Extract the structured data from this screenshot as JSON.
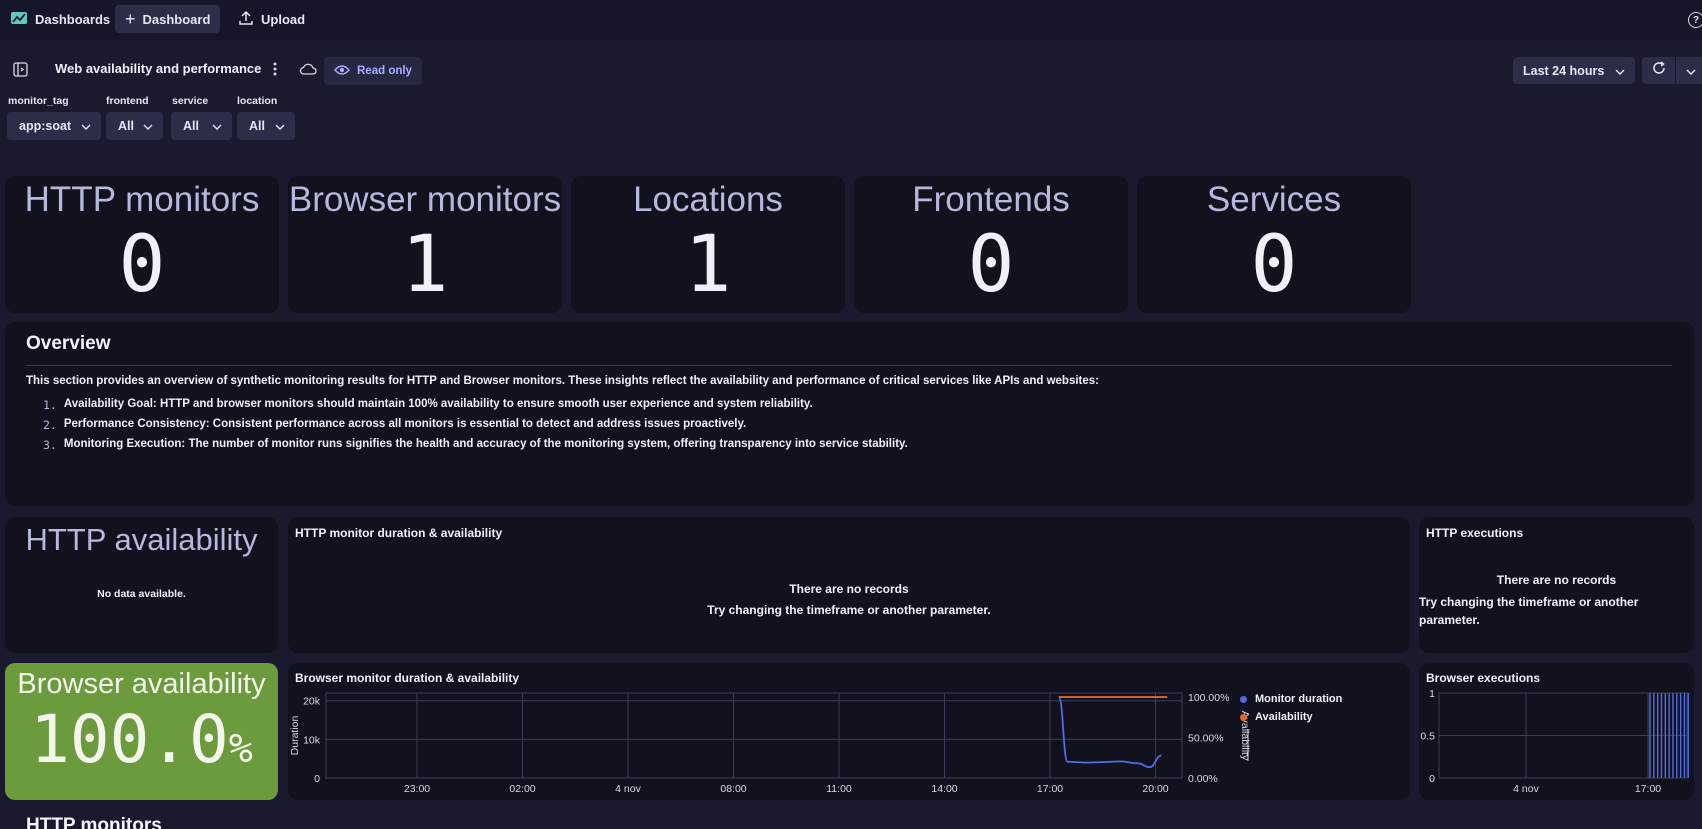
{
  "topbar": {
    "app_name": "Dashboards",
    "new_dashboard_label": "Dashboard",
    "upload_label": "Upload",
    "help_glyph": "?"
  },
  "toolbar": {
    "dashboard_title": "Web availability and performance",
    "read_only_label": "Read only",
    "timeframe_label": "Last 24 hours"
  },
  "filters": [
    {
      "label": "monitor_tag",
      "value": "app:soat"
    },
    {
      "label": "frontend",
      "value": "All"
    },
    {
      "label": "service",
      "value": "All"
    },
    {
      "label": "location",
      "value": "All"
    }
  ],
  "kpis": [
    {
      "title": "HTTP monitors",
      "value": "0"
    },
    {
      "title": "Browser monitors",
      "value": "1"
    },
    {
      "title": "Locations",
      "value": "1"
    },
    {
      "title": "Frontends",
      "value": "0"
    },
    {
      "title": "Services",
      "value": "0"
    }
  ],
  "overview": {
    "heading": "Overview",
    "intro": "This section provides an overview of synthetic monitoring results for HTTP and Browser monitors. These insights reflect the availability and performance of critical services like APIs and websites:",
    "items": [
      {
        "num": "1.",
        "title": "Availability Goal:",
        "text": " HTTP and browser monitors should maintain 100% availability to ensure smooth user experience and system reliability."
      },
      {
        "num": "2.",
        "title": "Performance Consistency:",
        "text": " Consistent performance across all monitors is essential to detect and address issues proactively."
      },
      {
        "num": "3.",
        "title": "Monitoring Execution:",
        "text": " The number of monitor runs signifies the health and accuracy of the monitoring system, offering transparency into service stability."
      }
    ]
  },
  "http_availability": {
    "title": "HTTP availability",
    "message": "No data available."
  },
  "http_duration": {
    "title": "HTTP monitor duration & availability",
    "no_records": "There are no records",
    "hint": "Try changing the timeframe or another parameter."
  },
  "http_executions": {
    "title": "HTTP executions",
    "no_records": "There are no records",
    "hint": "Try changing the timeframe or another parameter."
  },
  "browser_availability": {
    "title": "Browser availability",
    "value": "100.0",
    "unit": "%",
    "color": "#6c9b3e"
  },
  "browser_duration": {
    "title": "Browser monitor duration & availability",
    "y_axis_label": "Duration",
    "y2_axis_label": "Availability",
    "legend": [
      "Monitor duration",
      "Availability"
    ]
  },
  "browser_executions": {
    "title": "Browser executions"
  },
  "next_section": {
    "heading": "HTTP monitors"
  },
  "chart_data": [
    {
      "type": "line",
      "title": "Browser monitor duration & availability",
      "ylabel": "Duration",
      "y2label": "Availability",
      "x_ticks": [
        "23:00",
        "02:00",
        "4 nov",
        "08:00",
        "11:00",
        "14:00",
        "17:00",
        "20:00"
      ],
      "y_ticks": [
        "0",
        "10k",
        "20k"
      ],
      "y2_ticks": [
        "0.00%",
        "50.00%",
        "100.00%"
      ],
      "ylim": [
        0,
        22000
      ],
      "y2lim": [
        0,
        105
      ],
      "legend_position": "right",
      "series": [
        {
          "name": "Monitor duration",
          "axis": "left",
          "color": "#4f6de4",
          "x": [
            "17:15",
            "17:30",
            "18:00",
            "18:30",
            "19:00",
            "19:30",
            "19:50",
            "20:10"
          ],
          "values": [
            21000,
            4200,
            4000,
            4100,
            4300,
            3800,
            2800,
            5800
          ]
        },
        {
          "name": "Availability",
          "axis": "right",
          "color": "#e2672b",
          "x": [
            "17:15",
            "20:20"
          ],
          "values": [
            100,
            100
          ]
        }
      ]
    },
    {
      "type": "bar",
      "title": "Browser executions",
      "x_ticks": [
        "4 nov",
        "17:00"
      ],
      "y_ticks": [
        "0",
        "0.5",
        "1"
      ],
      "ylim": [
        0,
        1
      ],
      "series": [
        {
          "name": "",
          "color": "#4f6de4",
          "x": [
            "17:00",
            "17:20",
            "17:40",
            "18:00",
            "18:20",
            "18:40",
            "19:00",
            "19:20",
            "19:40",
            "20:00",
            "20:20"
          ],
          "values": [
            1,
            1,
            1,
            1,
            1,
            1,
            1,
            1,
            1,
            1,
            1
          ]
        }
      ]
    }
  ]
}
